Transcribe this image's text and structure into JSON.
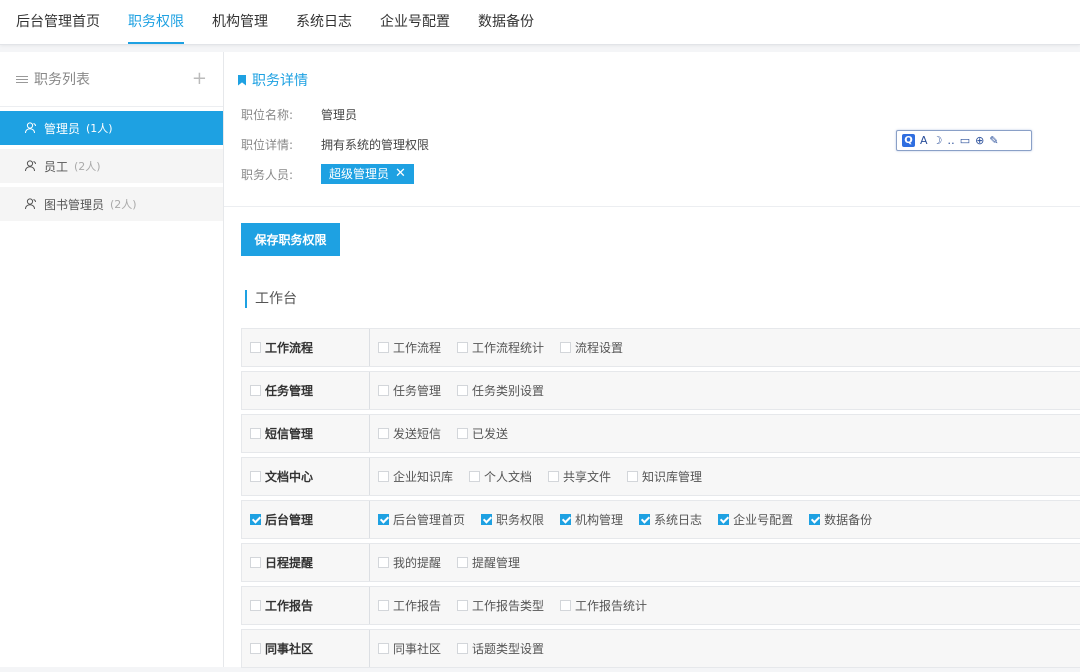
{
  "nav": {
    "tabs": [
      {
        "label": "后台管理首页",
        "active": false
      },
      {
        "label": "职务权限",
        "active": true
      },
      {
        "label": "机构管理",
        "active": false
      },
      {
        "label": "系统日志",
        "active": false
      },
      {
        "label": "企业号配置",
        "active": false
      },
      {
        "label": "数据备份",
        "active": false
      }
    ]
  },
  "sidebar": {
    "title": "职务列表",
    "add_symbol": "+",
    "items": [
      {
        "label": "管理员",
        "count": "(1人)",
        "active": true
      },
      {
        "label": "员工",
        "count": "(2人)",
        "active": false
      },
      {
        "label": "图书管理员",
        "count": "(2人)",
        "active": false
      }
    ]
  },
  "detail": {
    "heading": "职务详情",
    "name_label": "职位名称:",
    "name_value": "管理员",
    "desc_label": "职位详情:",
    "desc_value": "拥有系统的管理权限",
    "members_label": "职务人员:",
    "member_chip": "超级管理员",
    "chip_close": "✕"
  },
  "floating_toolbar": {
    "q_label": "Q",
    "items": [
      "A",
      "☽",
      "‥",
      "▭",
      "⊕",
      "✎"
    ]
  },
  "actions": {
    "save_label": "保存职务权限"
  },
  "section": {
    "title": "工作台"
  },
  "permissions": [
    {
      "category": "工作流程",
      "checked": false,
      "items": [
        {
          "label": "工作流程",
          "checked": false
        },
        {
          "label": "工作流程统计",
          "checked": false
        },
        {
          "label": "流程设置",
          "checked": false
        }
      ]
    },
    {
      "category": "任务管理",
      "checked": false,
      "items": [
        {
          "label": "任务管理",
          "checked": false
        },
        {
          "label": "任务类别设置",
          "checked": false
        }
      ]
    },
    {
      "category": "短信管理",
      "checked": false,
      "items": [
        {
          "label": "发送短信",
          "checked": false
        },
        {
          "label": "已发送",
          "checked": false
        }
      ]
    },
    {
      "category": "文档中心",
      "checked": false,
      "items": [
        {
          "label": "企业知识库",
          "checked": false
        },
        {
          "label": "个人文档",
          "checked": false
        },
        {
          "label": "共享文件",
          "checked": false
        },
        {
          "label": "知识库管理",
          "checked": false
        }
      ]
    },
    {
      "category": "后台管理",
      "checked": true,
      "items": [
        {
          "label": "后台管理首页",
          "checked": true
        },
        {
          "label": "职务权限",
          "checked": true
        },
        {
          "label": "机构管理",
          "checked": true
        },
        {
          "label": "系统日志",
          "checked": true
        },
        {
          "label": "企业号配置",
          "checked": true
        },
        {
          "label": "数据备份",
          "checked": true
        }
      ]
    },
    {
      "category": "日程提醒",
      "checked": false,
      "items": [
        {
          "label": "我的提醒",
          "checked": false
        },
        {
          "label": "提醒管理",
          "checked": false
        }
      ]
    },
    {
      "category": "工作报告",
      "checked": false,
      "items": [
        {
          "label": "工作报告",
          "checked": false
        },
        {
          "label": "工作报告类型",
          "checked": false
        },
        {
          "label": "工作报告统计",
          "checked": false
        }
      ]
    },
    {
      "category": "同事社区",
      "checked": false,
      "items": [
        {
          "label": "同事社区",
          "checked": false
        },
        {
          "label": "话题类型设置",
          "checked": false
        }
      ]
    }
  ]
}
